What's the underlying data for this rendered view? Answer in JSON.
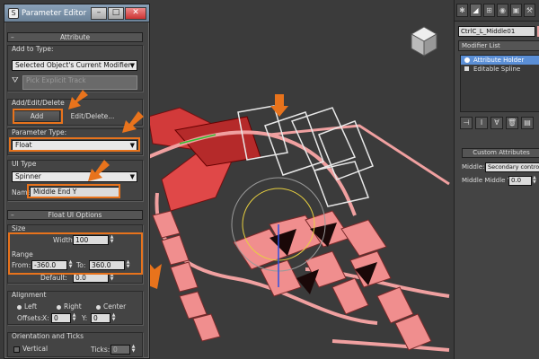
{
  "dialog": {
    "title": "Parameter Editor",
    "attribute_header": "Attribute",
    "add_to_type_label": "Add to Type:",
    "add_to_type_value": "Selected Object's Current Modifier",
    "pick_track_placeholder": "Pick Explicit Track",
    "add_edit_delete_label": "Add/Edit/Delete",
    "add_button": "Add",
    "edit_delete_button": "Edit/Delete...",
    "parameter_type_label": "Parameter Type:",
    "parameter_type_value": "Float",
    "ui_type_label": "UI Type",
    "ui_type_value": "Spinner",
    "name_label": "Name",
    "name_value": "Middle End Y",
    "float_ui_header": "Float UI Options",
    "size_label": "Size",
    "width_label": "Width:",
    "width_value": "100",
    "range_label": "Range",
    "from_label": "From:",
    "from_value": "-360.0",
    "to_label": "To:",
    "to_value": "360.0",
    "default_label": "Default:",
    "default_value": "0.0",
    "alignment_label": "Alignment",
    "left_label": "Left",
    "right_label": "Right",
    "center_label": "Center",
    "offsets_label": "Offsets:",
    "x_label": "X:",
    "x_value": "0",
    "y_label": "Y:",
    "y_value": "0",
    "orientation_label": "Orientation and Ticks",
    "vertical_label": "Vertical",
    "ticks_label": "Ticks:",
    "ticks_value": "0"
  },
  "panel": {
    "object_name": "CtrlC_L_Middle01",
    "modifier_list": "Modifier List",
    "stack_items": [
      "Attribute Holder",
      "Editable Spline"
    ],
    "custom_attributes_header": "Custom Attributes",
    "middle_label": "Middle:",
    "middle_value": "Secondary controls",
    "middle_middle_label": "Middle Middle Y:",
    "middle_middle_value": "0.0"
  },
  "colors": {
    "highlight": "#e8731c",
    "spline": "#f08e8e",
    "selected": "#5b8fd6"
  }
}
